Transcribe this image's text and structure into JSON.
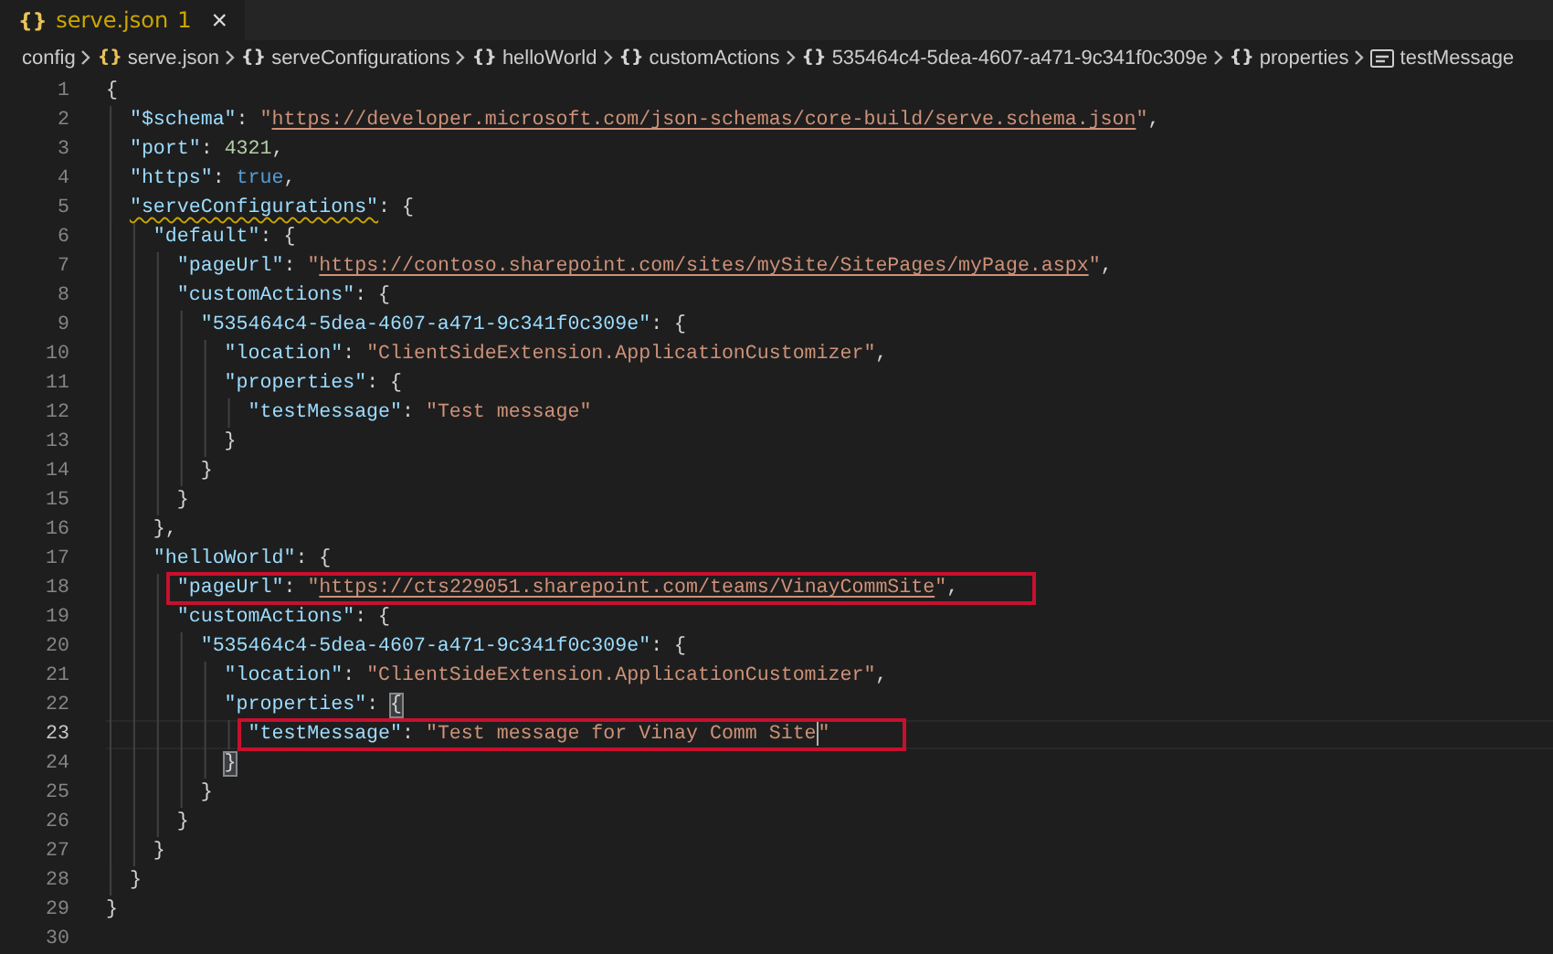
{
  "tab": {
    "icon": "{}",
    "label": "serve.json",
    "problems": "1",
    "close": "×"
  },
  "breadcrumbs": [
    {
      "kind": "folder",
      "label": "config"
    },
    {
      "kind": "file",
      "glyph": "{}",
      "label": "serve.json"
    },
    {
      "kind": "object",
      "glyph": "{}",
      "label": "serveConfigurations"
    },
    {
      "kind": "object",
      "glyph": "{}",
      "label": "helloWorld"
    },
    {
      "kind": "object",
      "glyph": "{}",
      "label": "customActions"
    },
    {
      "kind": "object",
      "glyph": "{}",
      "label": "535464c4-5dea-4607-a471-9c341f0c309e"
    },
    {
      "kind": "object",
      "glyph": "{}",
      "label": "properties"
    },
    {
      "kind": "string",
      "label": "testMessage"
    }
  ],
  "lines": [
    {
      "number": "1",
      "tokens": [
        {
          "kind": "punct",
          "text": "{"
        }
      ]
    },
    {
      "number": "2",
      "tokens": [
        {
          "kind": "key",
          "text": "  \"$schema\""
        },
        {
          "kind": "punct",
          "text": ": "
        },
        {
          "kind": "string",
          "text": "\""
        },
        {
          "kind": "link",
          "text": "https://developer.microsoft.com/json-schemas/core-build/serve.schema.json"
        },
        {
          "kind": "string",
          "text": "\""
        },
        {
          "kind": "punct",
          "text": ","
        }
      ]
    },
    {
      "number": "3",
      "tokens": [
        {
          "kind": "key",
          "text": "  \"port\""
        },
        {
          "kind": "punct",
          "text": ": "
        },
        {
          "kind": "number",
          "text": "4321"
        },
        {
          "kind": "punct",
          "text": ","
        }
      ]
    },
    {
      "number": "4",
      "tokens": [
        {
          "kind": "key",
          "text": "  \"https\""
        },
        {
          "kind": "punct",
          "text": ": "
        },
        {
          "kind": "keyword",
          "text": "true"
        },
        {
          "kind": "punct",
          "text": ","
        }
      ]
    },
    {
      "number": "5",
      "tokens": [
        {
          "kind": "key",
          "text": "  \"serveConfigurations\"",
          "warning": true
        },
        {
          "kind": "punct",
          "text": ": {"
        }
      ]
    },
    {
      "number": "6",
      "tokens": [
        {
          "kind": "key",
          "text": "    \"default\""
        },
        {
          "kind": "punct",
          "text": ": {"
        }
      ]
    },
    {
      "number": "7",
      "tokens": [
        {
          "kind": "key",
          "text": "      \"pageUrl\""
        },
        {
          "kind": "punct",
          "text": ": "
        },
        {
          "kind": "string",
          "text": "\""
        },
        {
          "kind": "link",
          "text": "https://contoso.sharepoint.com/sites/mySite/SitePages/myPage.aspx"
        },
        {
          "kind": "string",
          "text": "\""
        },
        {
          "kind": "punct",
          "text": ","
        }
      ]
    },
    {
      "number": "8",
      "tokens": [
        {
          "kind": "key",
          "text": "      \"customActions\""
        },
        {
          "kind": "punct",
          "text": ": {"
        }
      ]
    },
    {
      "number": "9",
      "tokens": [
        {
          "kind": "key",
          "text": "        \"535464c4-5dea-4607-a471-9c341f0c309e\""
        },
        {
          "kind": "punct",
          "text": ": {"
        }
      ]
    },
    {
      "number": "10",
      "tokens": [
        {
          "kind": "key",
          "text": "          \"location\""
        },
        {
          "kind": "punct",
          "text": ": "
        },
        {
          "kind": "string",
          "text": "\"ClientSideExtension.ApplicationCustomizer\""
        },
        {
          "kind": "punct",
          "text": ","
        }
      ]
    },
    {
      "number": "11",
      "tokens": [
        {
          "kind": "key",
          "text": "          \"properties\""
        },
        {
          "kind": "punct",
          "text": ": {"
        }
      ]
    },
    {
      "number": "12",
      "tokens": [
        {
          "kind": "key",
          "text": "            \"testMessage\""
        },
        {
          "kind": "punct",
          "text": ": "
        },
        {
          "kind": "string",
          "text": "\"Test message\""
        }
      ]
    },
    {
      "number": "13",
      "tokens": [
        {
          "kind": "punct",
          "text": "          }"
        }
      ]
    },
    {
      "number": "14",
      "tokens": [
        {
          "kind": "punct",
          "text": "        }"
        }
      ]
    },
    {
      "number": "15",
      "tokens": [
        {
          "kind": "punct",
          "text": "      }"
        }
      ]
    },
    {
      "number": "16",
      "tokens": [
        {
          "kind": "punct",
          "text": "    },"
        }
      ]
    },
    {
      "number": "17",
      "tokens": [
        {
          "kind": "key",
          "text": "    \"helloWorld\""
        },
        {
          "kind": "punct",
          "text": ": {"
        }
      ]
    },
    {
      "number": "18",
      "tokens": [
        {
          "kind": "key",
          "text": "      \"pageUrl\"",
          "boxed": true
        },
        {
          "kind": "punct",
          "text": ": ",
          "boxed": true
        },
        {
          "kind": "string",
          "text": "\"",
          "boxed": true
        },
        {
          "kind": "link",
          "text": "https://cts229051.sharepoint.com/teams/VinayCommSite",
          "boxed": true
        },
        {
          "kind": "string",
          "text": "\"",
          "boxed": true
        },
        {
          "kind": "punct",
          "text": ",",
          "boxed": true
        }
      ]
    },
    {
      "number": "19",
      "tokens": [
        {
          "kind": "key",
          "text": "      \"customActions\""
        },
        {
          "kind": "punct",
          "text": ": {"
        }
      ]
    },
    {
      "number": "20",
      "tokens": [
        {
          "kind": "key",
          "text": "        \"535464c4-5dea-4607-a471-9c341f0c309e\""
        },
        {
          "kind": "punct",
          "text": ": {"
        }
      ]
    },
    {
      "number": "21",
      "tokens": [
        {
          "kind": "key",
          "text": "          \"location\""
        },
        {
          "kind": "punct",
          "text": ": "
        },
        {
          "kind": "string",
          "text": "\"ClientSideExtension.ApplicationCustomizer\""
        },
        {
          "kind": "punct",
          "text": ","
        }
      ]
    },
    {
      "number": "22",
      "tokens": [
        {
          "kind": "key",
          "text": "          \"properties\""
        },
        {
          "kind": "punct",
          "text": ": "
        },
        {
          "kind": "punct",
          "text": "{",
          "matched": true
        }
      ]
    },
    {
      "number": "23",
      "current": true,
      "tokens": [
        {
          "kind": "key",
          "text": "            \"testMessage\"",
          "boxed": true
        },
        {
          "kind": "punct",
          "text": ": ",
          "boxed": true
        },
        {
          "kind": "string",
          "text": "\"Test message for Vinay Comm Site",
          "boxed": true,
          "cursor": true
        },
        {
          "kind": "string",
          "text": "\"",
          "boxed": true
        }
      ]
    },
    {
      "number": "24",
      "tokens": [
        {
          "kind": "punct",
          "text": "          }",
          "matched": true
        }
      ]
    },
    {
      "number": "25",
      "tokens": [
        {
          "kind": "punct",
          "text": "        }"
        }
      ]
    },
    {
      "number": "26",
      "tokens": [
        {
          "kind": "punct",
          "text": "      }"
        }
      ]
    },
    {
      "number": "27",
      "tokens": [
        {
          "kind": "punct",
          "text": "    }"
        }
      ]
    },
    {
      "number": "28",
      "tokens": [
        {
          "kind": "punct",
          "text": "  }"
        }
      ]
    },
    {
      "number": "29",
      "tokens": [
        {
          "kind": "punct",
          "text": "}"
        }
      ]
    },
    {
      "number": "30"
    }
  ]
}
